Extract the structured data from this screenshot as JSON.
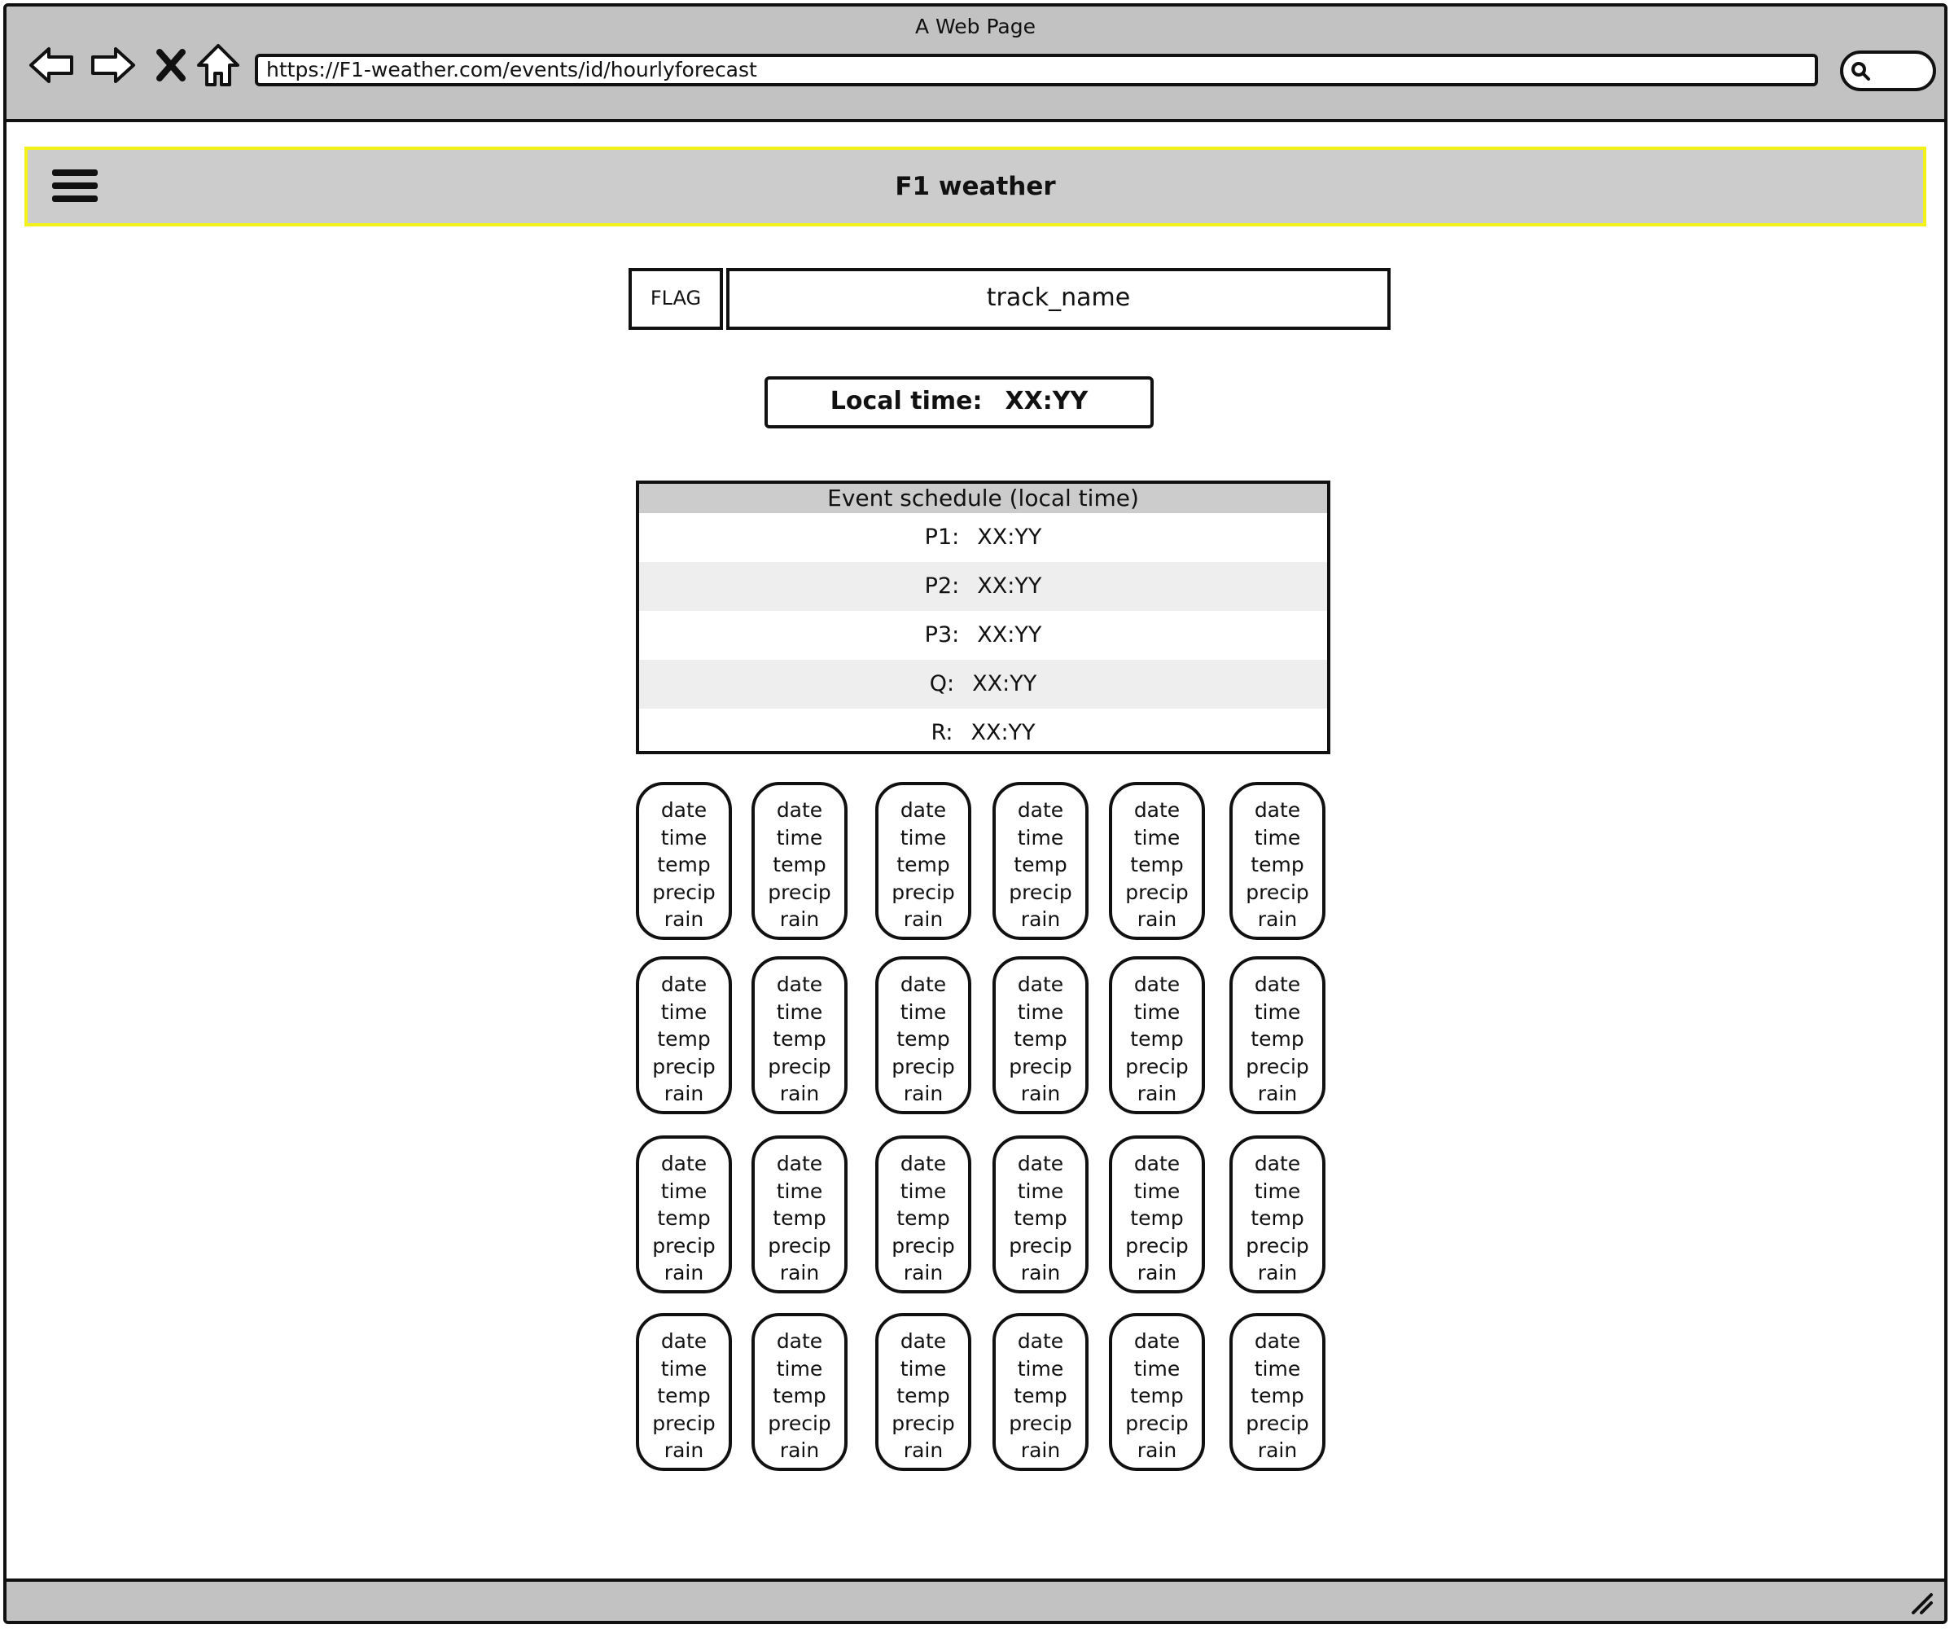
{
  "browser": {
    "window_title": "A Web Page",
    "url": "https://F1-weather.com/events/id/hourlyforecast",
    "icons": [
      "back-arrow-icon",
      "forward-arrow-icon",
      "close-icon",
      "home-icon",
      "search-icon"
    ]
  },
  "header": {
    "title": "F1 weather",
    "menu_icon": "hamburger-menu-icon",
    "accent_border": "#f2f21a"
  },
  "track": {
    "flag": "FLAG",
    "name": "track_name"
  },
  "local_time": {
    "label": "Local time:",
    "value": "XX:YY"
  },
  "schedule": {
    "title": "Event schedule (local time)",
    "sessions": [
      {
        "label": "P1:",
        "time": "XX:YY"
      },
      {
        "label": "P2:",
        "time": "XX:YY"
      },
      {
        "label": "P3:",
        "time": "XX:YY"
      },
      {
        "label": "Q:",
        "time": "XX:YY"
      },
      {
        "label": "R:",
        "time": "XX:YY"
      }
    ]
  },
  "forecast_card_fields": [
    "date",
    "time",
    "temp",
    "precip",
    "rain"
  ],
  "forecast_grid": {
    "rows": 4,
    "columns": 6
  }
}
